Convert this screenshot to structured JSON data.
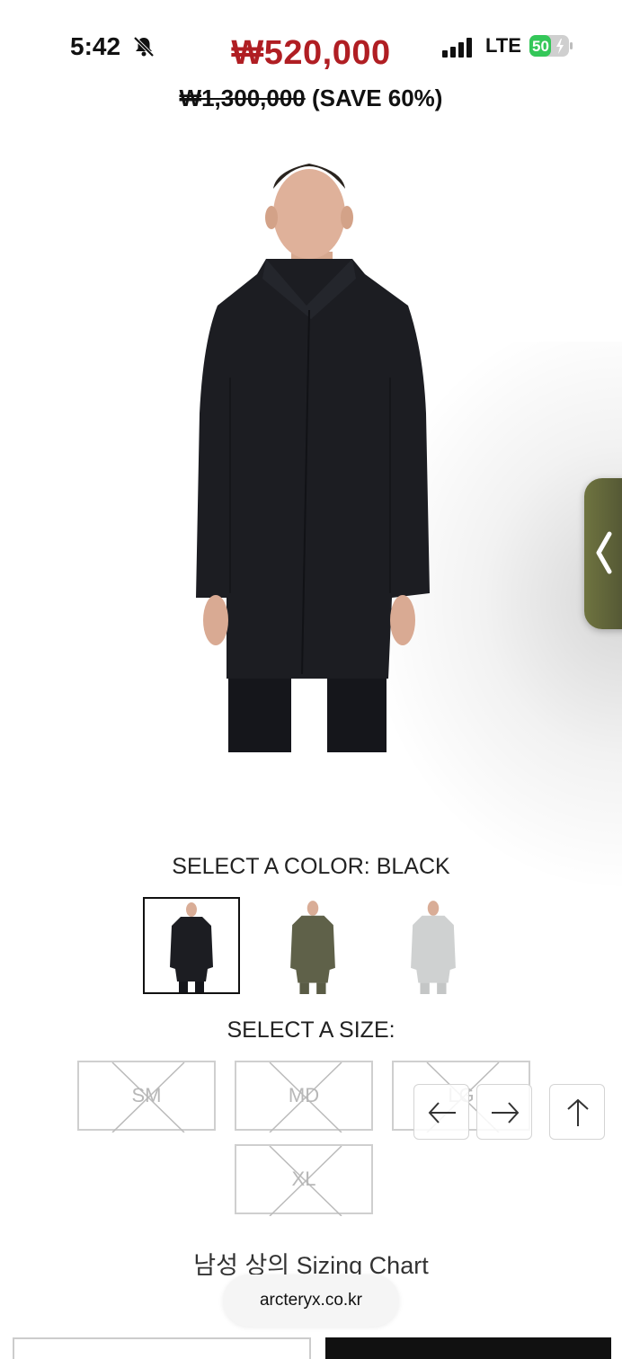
{
  "status_bar": {
    "time": "5:42",
    "network": "LTE",
    "battery": "50"
  },
  "price": {
    "sale": "₩520,000",
    "original": "₩1,300,000",
    "save": "(SAVE 60%)"
  },
  "color": {
    "label": "SELECT A COLOR:  BLACK",
    "selected": "BLACK",
    "swatch_colors": [
      "#1c1d22",
      "#5f6149",
      "#cfd1d1"
    ]
  },
  "size": {
    "label": "SELECT A SIZE:",
    "options": [
      "SM",
      "MD",
      "LG",
      "XL"
    ]
  },
  "sizing_chart": "남성 상의 Sizing Chart",
  "url": "arcteryx.co.kr",
  "icons": [
    "bell-slash-icon",
    "signal-icon",
    "battery-charging-icon",
    "chevron-left-icon",
    "arrow-left-icon",
    "arrow-right-icon",
    "arrow-up-icon"
  ]
}
